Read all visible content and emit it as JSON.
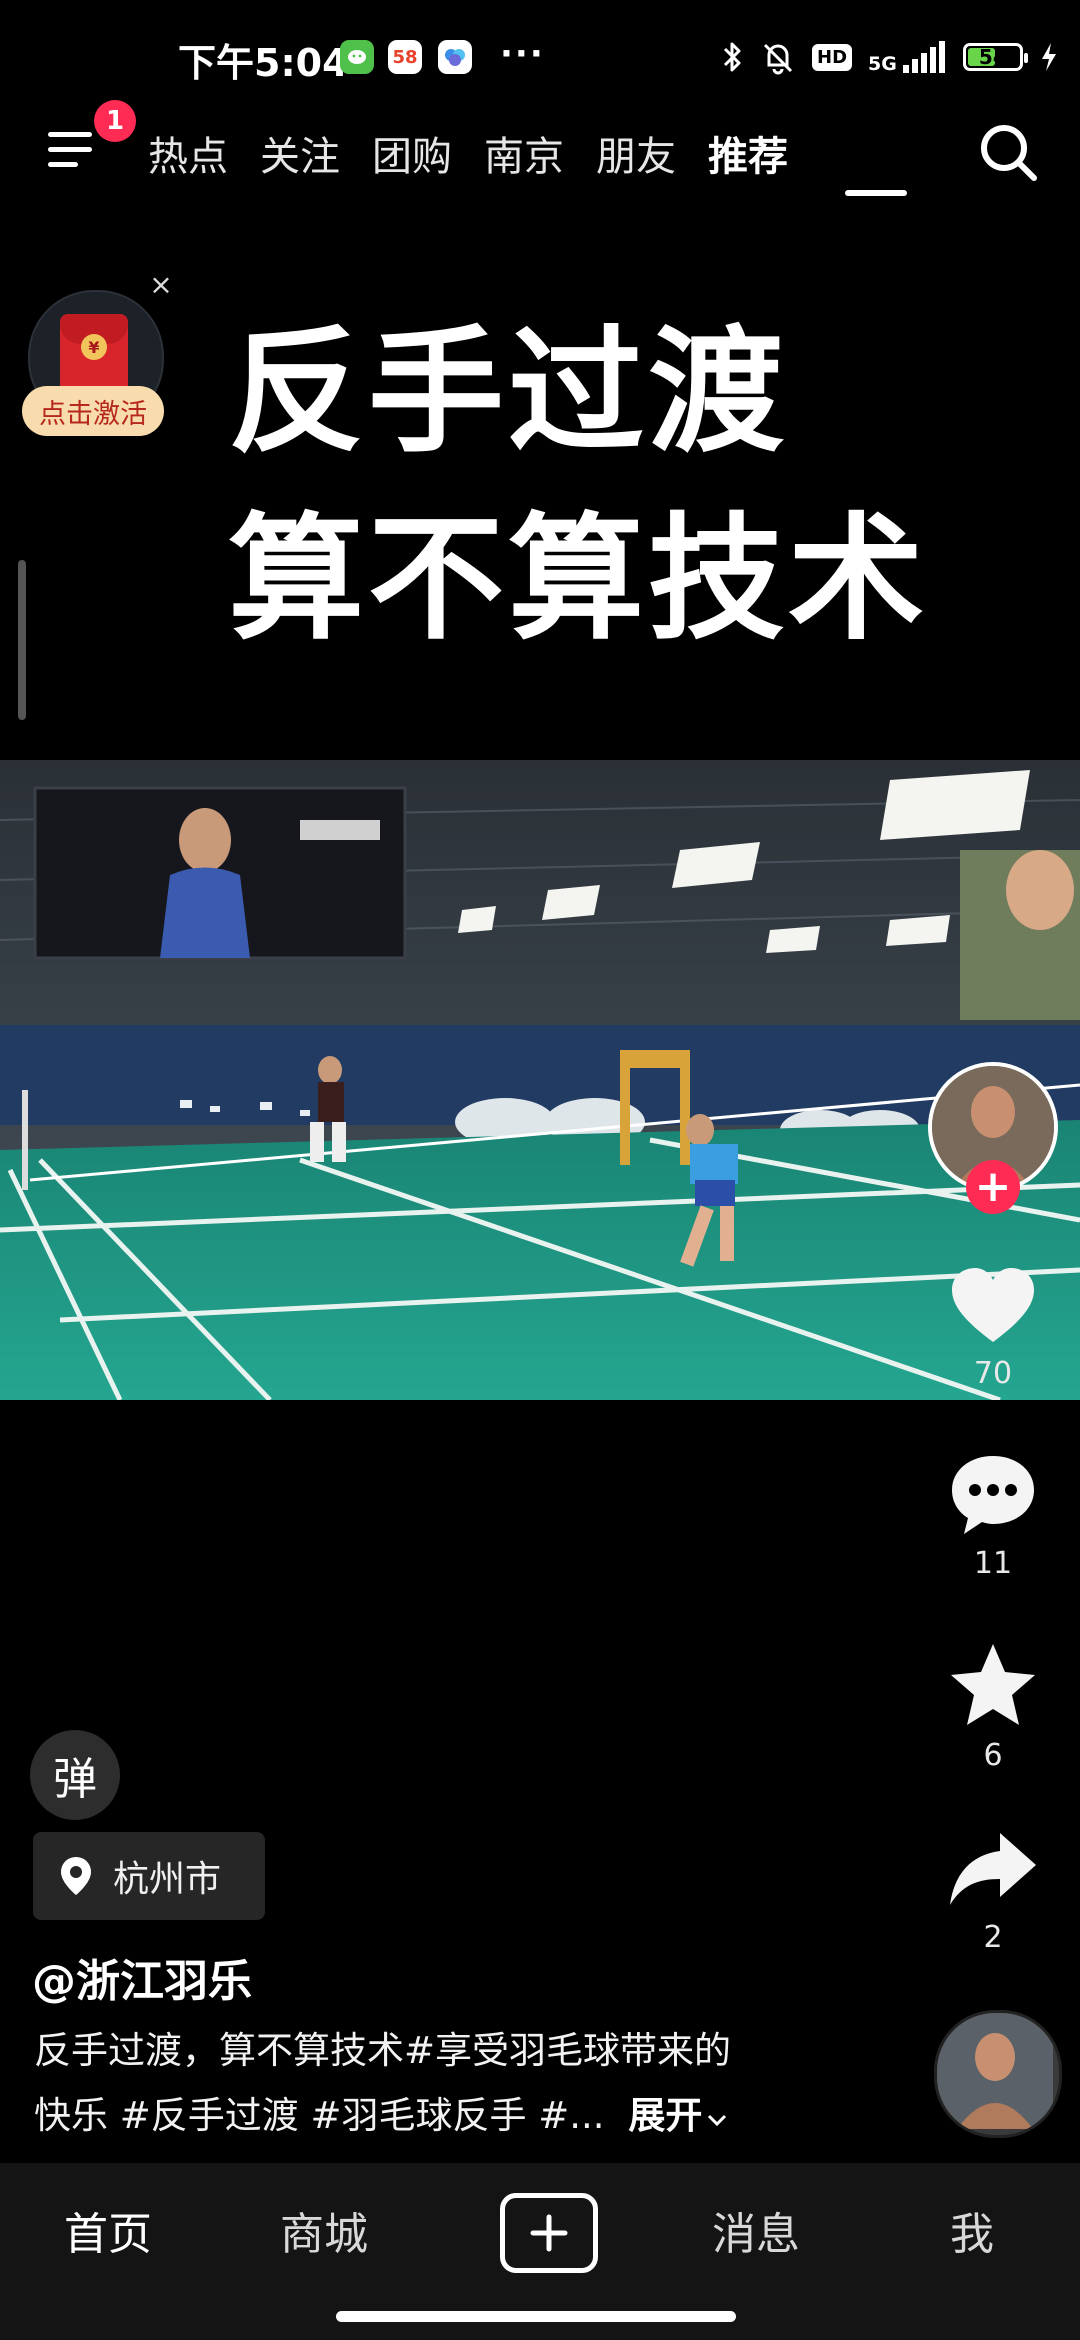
{
  "status_bar": {
    "time": "下午5:04",
    "app_58_label": "58",
    "dots": "···",
    "hd_label": "HD",
    "network_label": "5G",
    "battery": "54",
    "battery_level": 0.54
  },
  "top_nav": {
    "menu_badge": "1",
    "tabs": [
      {
        "label": "​"
      },
      {
        "label": "热点"
      },
      {
        "label": "关注"
      },
      {
        "label": "团购"
      },
      {
        "label": "南京"
      },
      {
        "label": "朋友"
      },
      {
        "label": "推荐",
        "active": true
      }
    ]
  },
  "red_packet": {
    "label": "点击激活",
    "close": "×"
  },
  "video": {
    "title_line_1": "反手过渡",
    "title_line_2": "算不算技术"
  },
  "actions": {
    "like_count": "70",
    "comment_count": "11",
    "favorite_count": "6",
    "share_count": "2"
  },
  "info": {
    "danmu_label": "弹",
    "location": "杭州市",
    "author": "@浙江羽乐",
    "caption_line_1": "反手过渡，算不算技术#享受羽毛球带来的",
    "caption_line_2": "快乐 #反手过渡 #羽毛球反手 #...",
    "expand_label": "展开"
  },
  "bottom_nav": {
    "home": "首页",
    "mall": "商城",
    "messages": "消息",
    "me": "我"
  },
  "colors": {
    "accent": "#fe2c55",
    "court": "#1f9a86"
  }
}
